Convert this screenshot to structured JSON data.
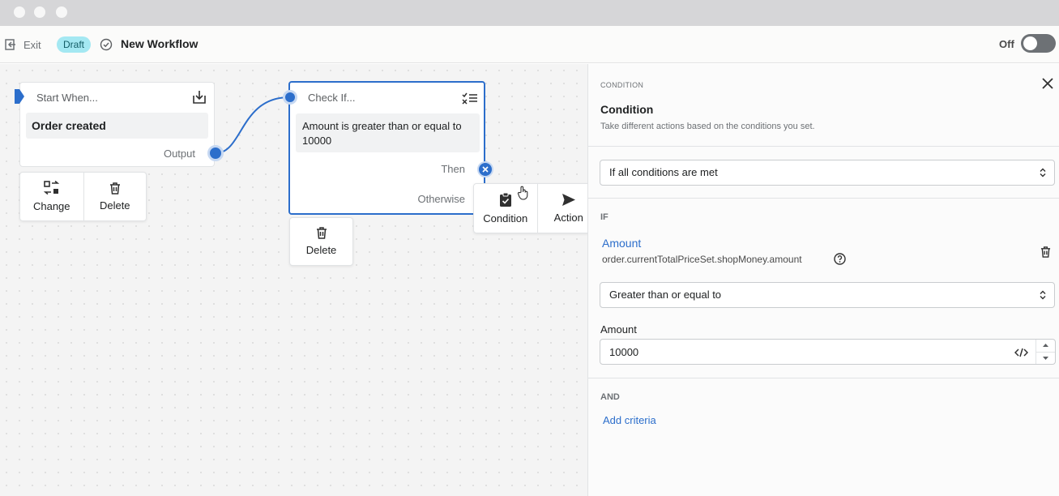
{
  "header": {
    "exit_label": "Exit",
    "status_badge": "Draft",
    "workflow_title": "New Workflow",
    "toggle_label": "Off"
  },
  "canvas": {
    "trigger_node": {
      "title": "Start When...",
      "event": "Order created",
      "output_label": "Output"
    },
    "trigger_actions": {
      "change_label": "Change",
      "delete_label": "Delete"
    },
    "condition_node": {
      "title": "Check If...",
      "summary": "Amount is greater than or equal to 10000",
      "then_label": "Then",
      "otherwise_label": "Otherwise"
    },
    "condition_actions": {
      "delete_label": "Delete"
    },
    "add_step_menu": {
      "condition_label": "Condition",
      "action_label": "Action"
    }
  },
  "panel": {
    "eyebrow": "CONDITION",
    "title": "Condition",
    "description": "Take different actions based on the conditions you set.",
    "match_select": "If all conditions are met",
    "if_label": "IF",
    "field_name": "Amount",
    "field_path": "order.currentTotalPriceSet.shopMoney.amount",
    "operator_select": "Greater than or equal to",
    "value_label": "Amount",
    "value": "10000",
    "and_label": "AND",
    "add_criteria_label": "Add criteria"
  },
  "colors": {
    "accent": "#2c6ecb",
    "badge_bg": "#a4e8f2",
    "toggle_off": "#6d7175",
    "canvas_bg": "#f4f4f4"
  }
}
